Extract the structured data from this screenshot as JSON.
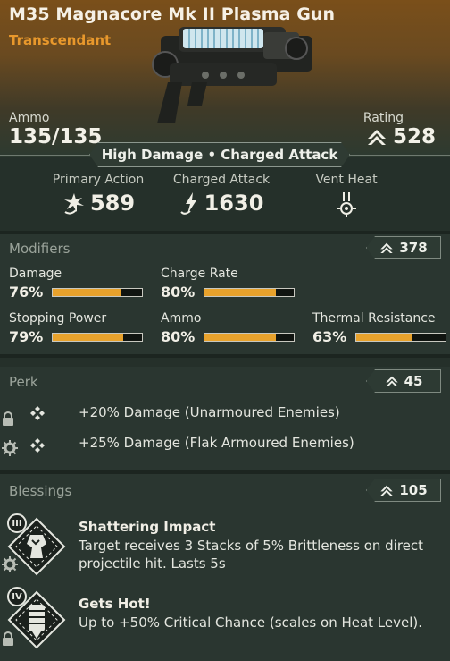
{
  "weapon": {
    "name": "M35 Magnacore Mk II Plasma Gun",
    "rarity": "Transcendant",
    "ammo_label": "Ammo",
    "ammo_value": "135/135",
    "rating_label": "Rating",
    "rating_value": "528",
    "banner": "High Damage • Charged Attack"
  },
  "actions": [
    {
      "label": "Primary Action",
      "value": "589",
      "icon": "primary-attack-icon"
    },
    {
      "label": "Charged Attack",
      "value": "1630",
      "icon": "charged-attack-icon"
    },
    {
      "label": "Vent Heat",
      "value": "",
      "icon": "vent-heat-icon"
    }
  ],
  "modifiers": {
    "title": "Modifiers",
    "score": "378",
    "stats": [
      {
        "name": "Damage",
        "pct": "76%",
        "fill": 0.76
      },
      {
        "name": "Charge Rate",
        "pct": "80%",
        "fill": 0.8
      },
      {
        "name": "Stopping Power",
        "pct": "79%",
        "fill": 0.79
      },
      {
        "name": "Ammo",
        "pct": "80%",
        "fill": 0.8
      },
      {
        "name": "Thermal Resistance",
        "pct": "63%",
        "fill": 0.63
      }
    ]
  },
  "perk": {
    "title": "Perk",
    "score": "45",
    "items": [
      {
        "text": "+20% Damage (Unarmoured Enemies)",
        "state_icon": "lock-icon"
      },
      {
        "text": "+25% Damage (Flak Armoured Enemies)",
        "state_icon": "gear-icon"
      }
    ]
  },
  "blessings": {
    "title": "Blessings",
    "score": "105",
    "items": [
      {
        "tier": "III",
        "name": "Shattering Impact",
        "desc": "Target receives 3 Stacks of 5% Brittleness on direct projectile hit. Lasts 5s"
      },
      {
        "tier": "IV",
        "name": "Gets Hot!",
        "desc": "Up to +50% Critical Chance (scales on Heat Level)."
      }
    ]
  },
  "colors": {
    "accent": "#e8982c",
    "bar_fill": "#e8a22c",
    "panel": "#2a3630"
  }
}
